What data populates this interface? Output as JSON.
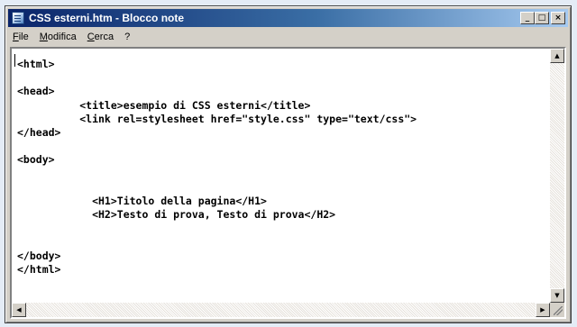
{
  "window": {
    "title": "CSS esterni.htm - Blocco note",
    "buttons": {
      "minimize": "_",
      "maximize": "□",
      "close": "×"
    }
  },
  "menu": [
    "File",
    "Modifica",
    "Cerca",
    "?"
  ],
  "editor": {
    "lines": [
      "<html>",
      "",
      "<head>",
      "          <title>esempio di CSS esterni</title>",
      "          <link rel=stylesheet href=\"style.css\" type=\"text/css\">",
      "</head>",
      "",
      "<body>",
      "",
      "",
      "            <H1>Titolo della pagina</H1>",
      "            <H2>Testo di prova, Testo di prova</H2>",
      "",
      "",
      "</body>",
      "</html>"
    ]
  },
  "scrollbars": {
    "up_arrow": "▲",
    "down_arrow": "▼",
    "left_arrow": "◀",
    "right_arrow": "▶"
  }
}
